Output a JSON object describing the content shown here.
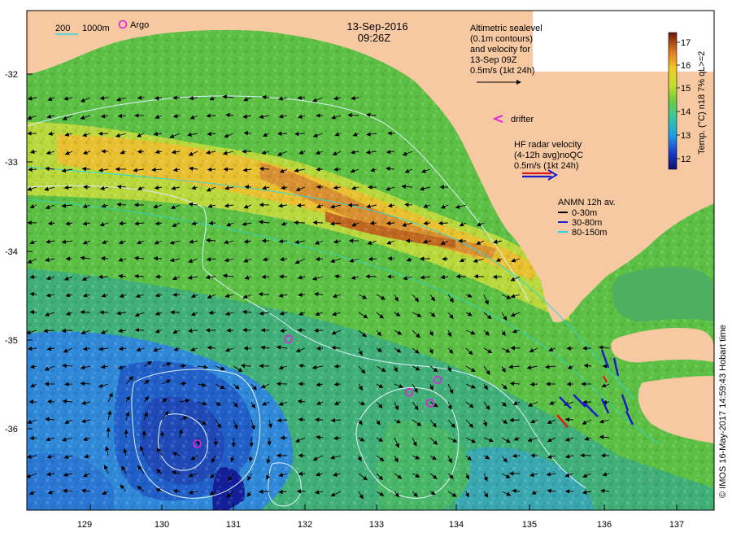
{
  "date": "13-Sep-2016",
  "time": "09:26Z",
  "contour_legend": {
    "label_200": "200",
    "label_1000": "1000m"
  },
  "argo_label": "Argo",
  "altimetry_lines": [
    "Altimetric sealevel",
    "(0.1m contours)",
    "and velocity for",
    "13-Sep 09Z",
    "0.5m/s (1kt 24h)"
  ],
  "drifter_label": "drifter",
  "hf_radar_lines": [
    "HF radar velocity",
    "(4-12h avg)noQC",
    "0.5m/s (1kt 24h)"
  ],
  "anmn": {
    "title": "ANMN 12h av.",
    "items": [
      {
        "label": "0-30m",
        "color": "#000000"
      },
      {
        "label": "30-80m",
        "color": "#1a1acc"
      },
      {
        "label": "80-150m",
        "color": "#22d8e8"
      }
    ]
  },
  "colorbar": {
    "ticks": [
      "17",
      "16",
      "15",
      "14",
      "13",
      "12"
    ],
    "label": "Temp. (°C) n18 7% qL>=2"
  },
  "credit": "© IMOS 16-May-2017 14:59:43 Hobart time",
  "lat_labels": [
    "-32",
    "-33",
    "-34",
    "-35",
    "-36"
  ],
  "lon_labels": [
    "129",
    "130",
    "131",
    "132",
    "133",
    "134",
    "135",
    "136",
    "137"
  ],
  "colors": {
    "land": "#f7c9a2",
    "argo": "#e020e0",
    "contour": "#d8f0ff",
    "hf_red": "#e01818",
    "hf_blue": "#1a1acc"
  },
  "argo_floats": [
    {
      "lon": 129.55,
      "lat": -31.4
    },
    {
      "lon": 131.72,
      "lat": -34.99
    },
    {
      "lon": 133.38,
      "lat": -35.59
    },
    {
      "lon": 133.67,
      "lat": -35.71
    },
    {
      "lon": 133.77,
      "lat": -35.45
    },
    {
      "lon": 130.47,
      "lat": -36.17
    }
  ]
}
